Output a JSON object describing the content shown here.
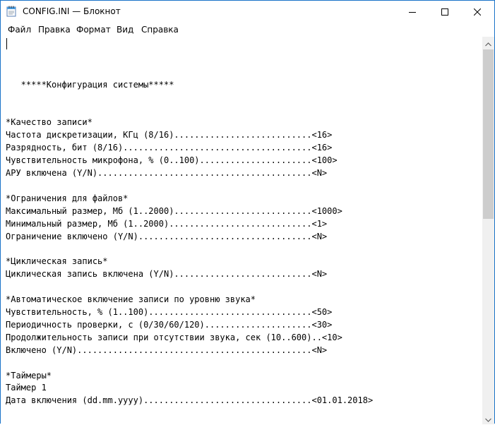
{
  "window": {
    "title": "CONFIG.INI — Блокнот",
    "accent_color": "#1a73c8",
    "icons": {
      "app": "notepad-icon",
      "minimize": "minimize-icon",
      "maximize": "maximize-icon",
      "close": "close-icon"
    }
  },
  "menu": {
    "file": "Файл",
    "edit": "Правка",
    "format": "Формат",
    "view": "Вид",
    "help": "Справка"
  },
  "document": {
    "lines": [
      "",
      "",
      "",
      "   *****Конфигурация системы*****",
      "",
      "",
      "*Качество записи*",
      "Частота дискретизации, КГц (8/16)...........................<16>",
      "Разрядность, бит (8/16).....................................<16>",
      "Чувствительность микрофона, % (0..100)......................<100>",
      "АРУ включена (Y/N)..........................................<N>",
      "",
      "*Ограничения для файлов*",
      "Максимальный размер, Мб (1..2000)...........................<1000>",
      "Минимальный размер, Мб (1..2000)............................<1>",
      "Ограничение включено (Y/N)..................................<N>",
      "",
      "*Циклическая запись*",
      "Циклическая запись включена (Y/N)...........................<N>",
      "",
      "*Автоматическое включение записи по уровню звука*",
      "Чувствительность, % (1..100)................................<50>",
      "Периодичность проверки, с (0/30/60/120).....................<30>",
      "Продолжительность записи при отсутствии звука, сек (10..600)..<10>",
      "Включено (Y/N)..............................................<N>",
      "",
      "*Таймеры*",
      "Таймер 1",
      "Дата включения (dd.mm.yyyy).................................<01.01.2018>"
    ]
  },
  "scrollbar": {
    "position": 0,
    "icons": {
      "up": "chevron-up-icon",
      "down": "chevron-down-icon"
    }
  }
}
